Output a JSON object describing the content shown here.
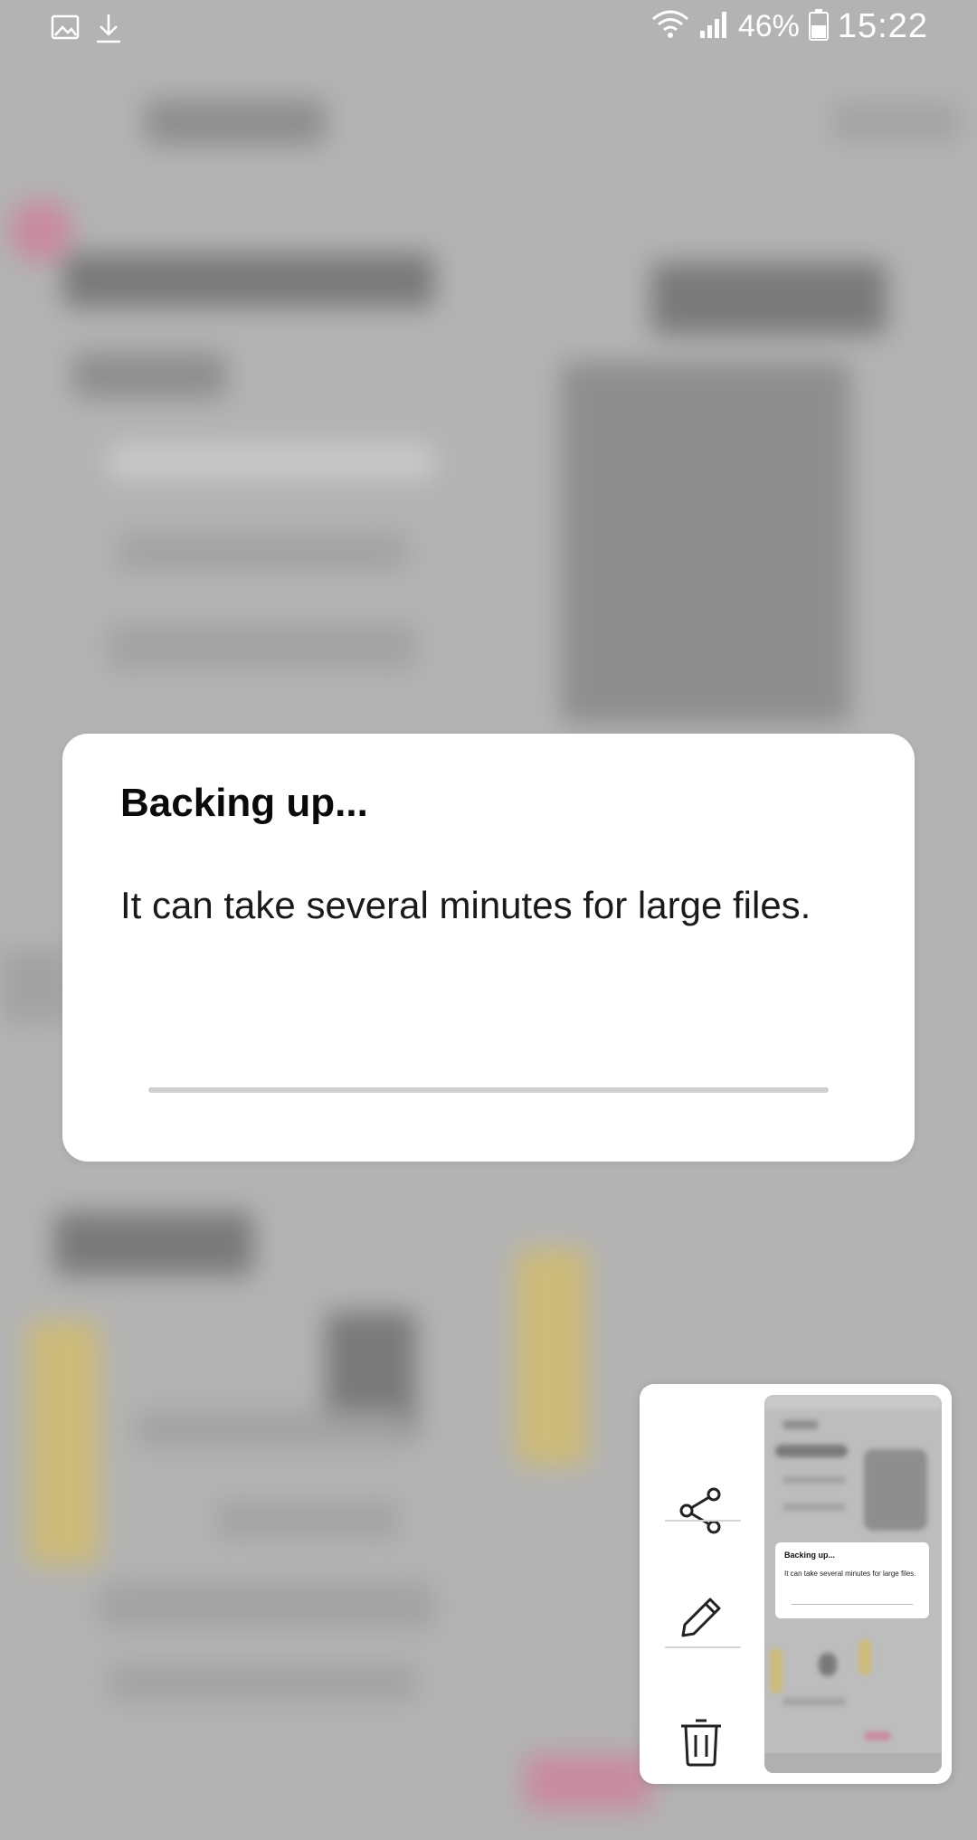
{
  "status_bar": {
    "left_icons": [
      "gallery-icon",
      "download-icon"
    ],
    "right_icons": [
      "wifi-icon",
      "signal-icon",
      "battery-icon"
    ],
    "battery_percent": "46%",
    "time": "15:22"
  },
  "dialog": {
    "title": "Backing up...",
    "message": "It can take several minutes for large files.",
    "progress": 0
  },
  "screenshot_panel": {
    "actions": [
      "share-icon",
      "edit-icon",
      "delete-icon"
    ],
    "thumbnail": {
      "dialog_title": "Backing up...",
      "dialog_message": "It can take several minutes for large files."
    }
  }
}
